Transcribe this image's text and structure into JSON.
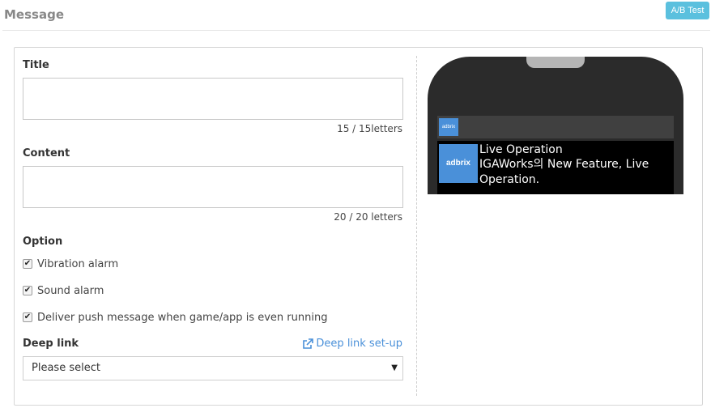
{
  "header": {
    "title": "Message",
    "ab_test_label": "A/B Test"
  },
  "form": {
    "title_label": "Title",
    "title_value": "",
    "title_counter": "15 / 15letters",
    "content_label": "Content",
    "content_value": "",
    "content_counter": "20 / 20 letters",
    "option_label": "Option",
    "options": [
      {
        "label": "Vibration alarm",
        "checked": true
      },
      {
        "label": "Sound alarm",
        "checked": true
      },
      {
        "label": "Deliver push message when game/app is even running",
        "checked": true
      }
    ],
    "deeplink_label": "Deep link",
    "deeplink_setup_link": "Deep link set-up",
    "deeplink_select_value": "Please select"
  },
  "preview": {
    "status_logo_text": "adbrix",
    "notif_logo_text": "adbrix",
    "notif_title": "Live Operation",
    "notif_text": "IGAWorks의 New Feature, Live Operation."
  },
  "colors": {
    "accent": "#5bc0de",
    "link": "#4a90d9",
    "logo_bg": "#4a90d9"
  },
  "icons": {
    "checkbox": "check-mark",
    "deeplink": "external-link-icon",
    "select": "caret-down-icon"
  }
}
